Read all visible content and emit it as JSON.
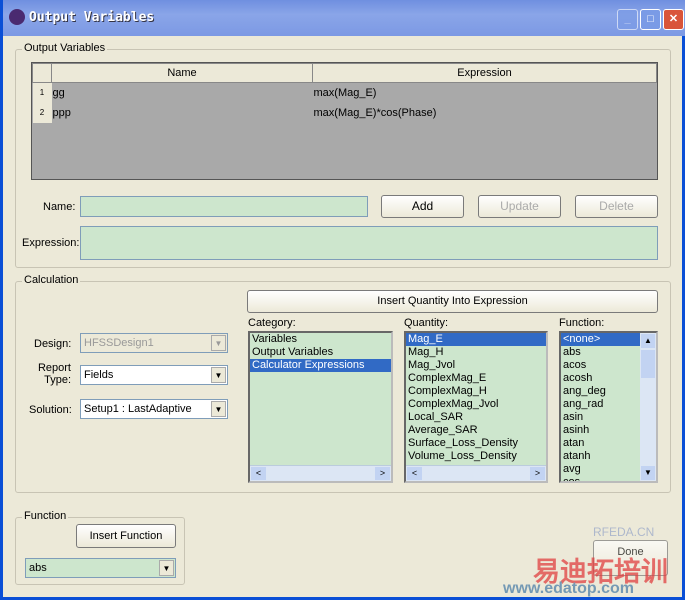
{
  "window": {
    "title": "Output Variables"
  },
  "output_group": {
    "label": "Output Variables",
    "columns": [
      "Name",
      "Expression"
    ],
    "rows": [
      {
        "num": "1",
        "name": "gg",
        "expr": "max(Mag_E)"
      },
      {
        "num": "2",
        "name": "ppp",
        "expr": "max(Mag_E)*cos(Phase)"
      }
    ]
  },
  "form": {
    "name_label": "Name:",
    "name_value": "",
    "expr_label": "Expression:",
    "expr_value": "",
    "add": "Add",
    "update": "Update",
    "delete": "Delete"
  },
  "calc": {
    "label": "Calculation",
    "insert_quantity": "Insert Quantity Into Expression",
    "design_label": "Design:",
    "design_value": "HFSSDesign1",
    "report_label": "Report Type:",
    "report_value": "Fields",
    "solution_label": "Solution:",
    "solution_value": "Setup1 : LastAdaptive",
    "category_label": "Category:",
    "categories": [
      "Variables",
      "Output Variables",
      "Calculator Expressions"
    ],
    "quantity_label": "Quantity:",
    "quantities": [
      "Mag_E",
      "Mag_H",
      "Mag_Jvol",
      "ComplexMag_E",
      "ComplexMag_H",
      "ComplexMag_Jvol",
      "Local_SAR",
      "Average_SAR",
      "Surface_Loss_Density",
      "Volume_Loss_Density"
    ],
    "function_label": "Function:",
    "functions": [
      "<none>",
      "abs",
      "acos",
      "acosh",
      "ang_deg",
      "ang_rad",
      "asin",
      "asinh",
      "atan",
      "atanh",
      "avg",
      "cos"
    ]
  },
  "function_group": {
    "label": "Function",
    "insert": "Insert Function",
    "value": "abs"
  },
  "done": "Done",
  "watermark": {
    "site": "RFEDA.CN",
    "cn": "易迪拓培训",
    "url": "www.edatop.com"
  }
}
